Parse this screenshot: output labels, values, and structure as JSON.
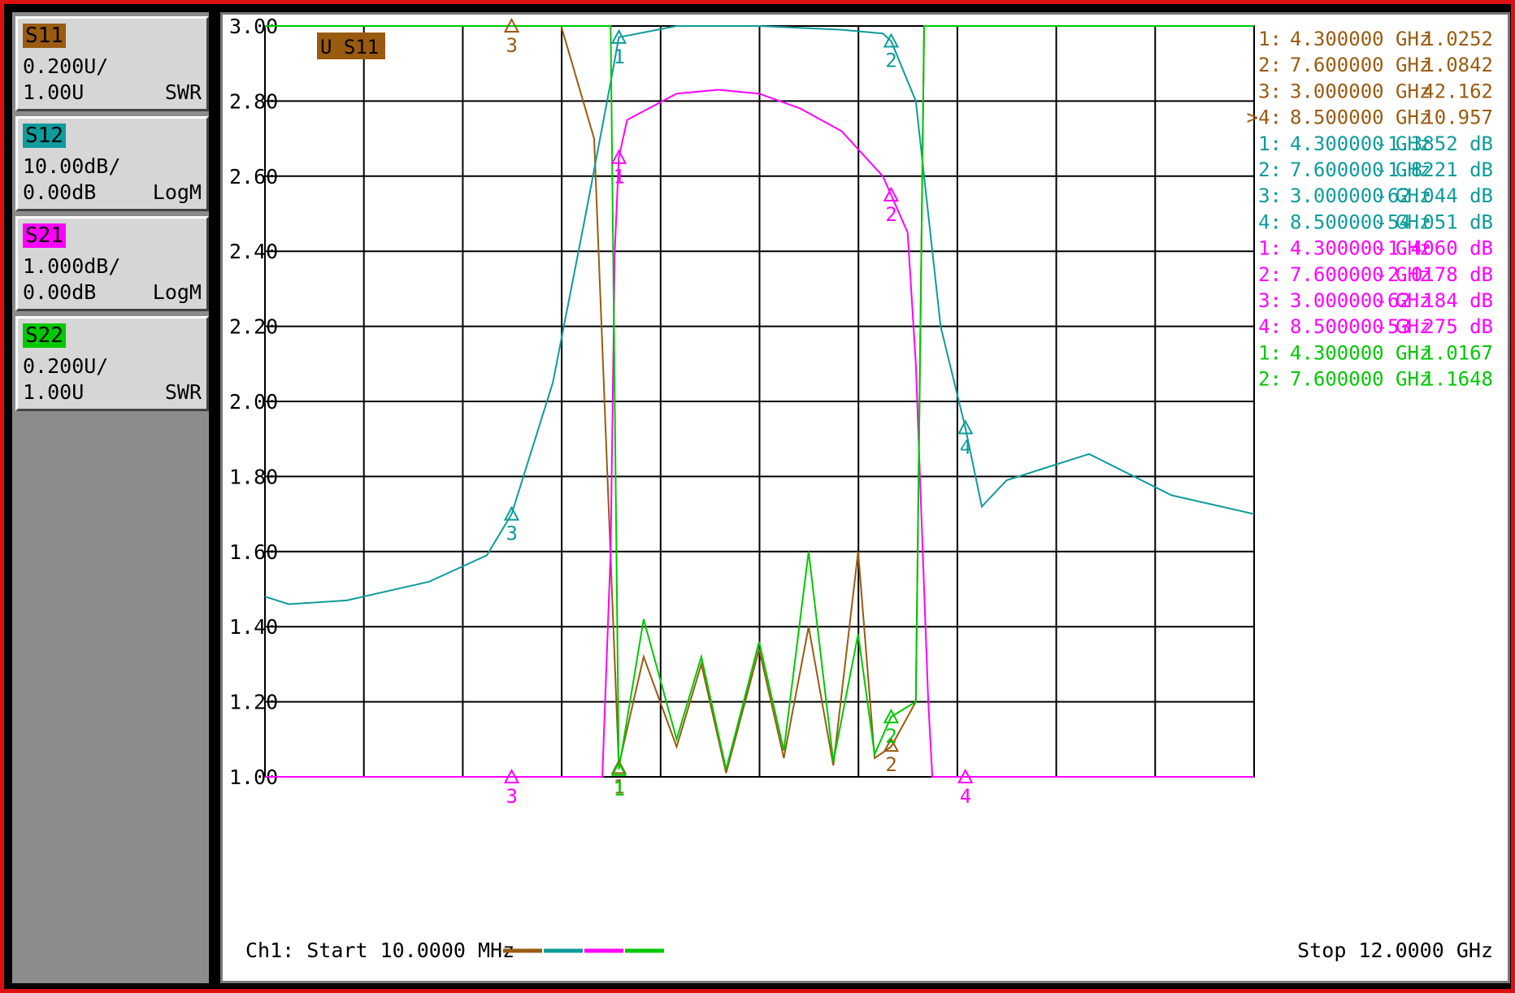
{
  "traces": [
    {
      "name": "S11",
      "scale": "0.200U/",
      "ref": "1.00U",
      "format": "SWR",
      "color": "#9a5b10"
    },
    {
      "name": "S12",
      "scale": "10.00dB/",
      "ref": "0.00dB",
      "format": "LogM",
      "color": "#0e9b9b"
    },
    {
      "name": "S21",
      "scale": "1.000dB/",
      "ref": "0.00dB",
      "format": "LogM",
      "color": "#ff00ff"
    },
    {
      "name": "S22",
      "scale": "0.200U/",
      "ref": "1.00U",
      "format": "SWR",
      "color": "#00c800"
    }
  ],
  "active_trace_label": "U S11",
  "footer": {
    "start": "Ch1: Start  10.0000 MHz",
    "stop": "Stop  12.0000 GHz"
  },
  "marker_table": [
    {
      "trace": "S11",
      "num": "1:",
      "freq": "4.300000 GHz",
      "value": "1.0252"
    },
    {
      "trace": "S11",
      "num": "2:",
      "freq": "7.600000 GHz",
      "value": "1.0842"
    },
    {
      "trace": "S11",
      "num": "3:",
      "freq": "3.000000 GHz",
      "value": "42.162"
    },
    {
      "trace": "S11",
      "num": ">4:",
      "freq": "8.500000 GHz",
      "value": "10.957"
    },
    {
      "trace": "S12",
      "num": "1:",
      "freq": "4.300000 GHz",
      "value": "-1.3852 dB"
    },
    {
      "trace": "S12",
      "num": "2:",
      "freq": "7.600000 GHz",
      "value": "-1.8221 dB"
    },
    {
      "trace": "S12",
      "num": "3:",
      "freq": "3.000000 GHz",
      "value": "-62.044 dB"
    },
    {
      "trace": "S12",
      "num": "4:",
      "freq": "8.500000 GHz",
      "value": "-54.051 dB"
    },
    {
      "trace": "S21",
      "num": "1:",
      "freq": "4.300000 GHz",
      "value": "-1.4060 dB"
    },
    {
      "trace": "S21",
      "num": "2:",
      "freq": "7.600000 GHz",
      "value": "-2.0178 dB"
    },
    {
      "trace": "S21",
      "num": "3:",
      "freq": "3.000000 GHz",
      "value": "-62.184 dB"
    },
    {
      "trace": "S21",
      "num": "4:",
      "freq": "8.500000 GHz",
      "value": "-53.275 dB"
    },
    {
      "trace": "S22",
      "num": "1:",
      "freq": "4.300000 GHz",
      "value": "1.0167"
    },
    {
      "trace": "S22",
      "num": "2:",
      "freq": "7.600000 GHz",
      "value": "1.1648"
    }
  ],
  "chart_data": {
    "type": "line",
    "xlabel": "",
    "ylabel": "",
    "xlim": [
      0.01,
      12.0
    ],
    "ylim": [
      1.0,
      3.0
    ],
    "yticks": [
      "3.00",
      "2.80",
      "2.60",
      "2.40",
      "2.20",
      "2.00",
      "1.80",
      "1.60",
      "1.40",
      "1.20",
      "1.00"
    ],
    "grid": true,
    "series": [
      {
        "name": "S11",
        "x": [
          0.01,
          1,
          2,
          3,
          3.6,
          4.0,
          4.3,
          4.6,
          5.0,
          5.3,
          5.6,
          6.0,
          6.3,
          6.6,
          6.9,
          7.2,
          7.4,
          7.6,
          7.9,
          8.0,
          8.5,
          12.0
        ],
        "y": [
          3.0,
          3.0,
          3.0,
          3.0,
          3.0,
          2.7,
          1.03,
          1.32,
          1.08,
          1.3,
          1.01,
          1.34,
          1.05,
          1.4,
          1.03,
          1.6,
          1.05,
          1.08,
          1.2,
          3.0,
          3.0,
          3.0
        ]
      },
      {
        "name": "S12",
        "x": [
          0.01,
          0.3,
          1,
          2,
          2.7,
          3.0,
          3.5,
          3.9,
          4.2,
          4.3,
          5,
          6,
          7,
          7.5,
          7.6,
          7.9,
          8.2,
          8.5,
          8.7,
          9,
          10,
          11,
          12
        ],
        "y": [
          1.48,
          1.46,
          1.47,
          1.52,
          1.59,
          1.7,
          2.05,
          2.5,
          2.85,
          2.97,
          3.0,
          3.0,
          2.99,
          2.98,
          2.96,
          2.8,
          2.2,
          1.93,
          1.72,
          1.79,
          1.86,
          1.75,
          1.7
        ]
      },
      {
        "name": "S21",
        "x": [
          0.01,
          4.1,
          4.2,
          4.25,
          4.3,
          4.4,
          5,
          5.5,
          6.0,
          6.5,
          7.0,
          7.5,
          7.6,
          7.8,
          7.9,
          8.05,
          8.1,
          12.0
        ],
        "y": [
          1.0,
          1.0,
          1.6,
          2.4,
          2.65,
          2.75,
          2.82,
          2.83,
          2.82,
          2.78,
          2.72,
          2.6,
          2.55,
          2.45,
          2.1,
          1.2,
          1.0,
          1.0
        ]
      },
      {
        "name": "S22",
        "x": [
          0.01,
          4.1,
          4.2,
          4.3,
          4.6,
          5.0,
          5.3,
          5.6,
          6.0,
          6.3,
          6.6,
          6.9,
          7.2,
          7.4,
          7.6,
          7.9,
          8.0,
          12.0
        ],
        "y": [
          3.0,
          3.0,
          3.0,
          1.02,
          1.42,
          1.1,
          1.32,
          1.02,
          1.36,
          1.07,
          1.6,
          1.04,
          1.38,
          1.06,
          1.16,
          1.2,
          3.0,
          3.0
        ]
      }
    ],
    "markers": [
      {
        "trace": "S11",
        "label": "1",
        "x": 4.3,
        "y": 1.0252
      },
      {
        "trace": "S11",
        "label": "2",
        "x": 7.6,
        "y": 1.0842
      },
      {
        "trace": "S11",
        "label": "3",
        "x": 3.0,
        "y": 3.0
      },
      {
        "trace": "S12",
        "label": "1",
        "x": 4.3,
        "y": 2.97
      },
      {
        "trace": "S12",
        "label": "2",
        "x": 7.6,
        "y": 2.96
      },
      {
        "trace": "S12",
        "label": "3",
        "x": 3.0,
        "y": 1.7
      },
      {
        "trace": "S12",
        "label": "4",
        "x": 8.5,
        "y": 1.93
      },
      {
        "trace": "S21",
        "label": "1",
        "x": 4.3,
        "y": 2.65
      },
      {
        "trace": "S21",
        "label": "2",
        "x": 7.6,
        "y": 2.55
      },
      {
        "trace": "S21",
        "label": "3",
        "x": 3.0,
        "y": 1.0
      },
      {
        "trace": "S21",
        "label": "4",
        "x": 8.5,
        "y": 1.0
      },
      {
        "trace": "S22",
        "label": "1",
        "x": 4.3,
        "y": 1.02
      },
      {
        "trace": "S22",
        "label": "2",
        "x": 7.6,
        "y": 1.16
      }
    ]
  }
}
